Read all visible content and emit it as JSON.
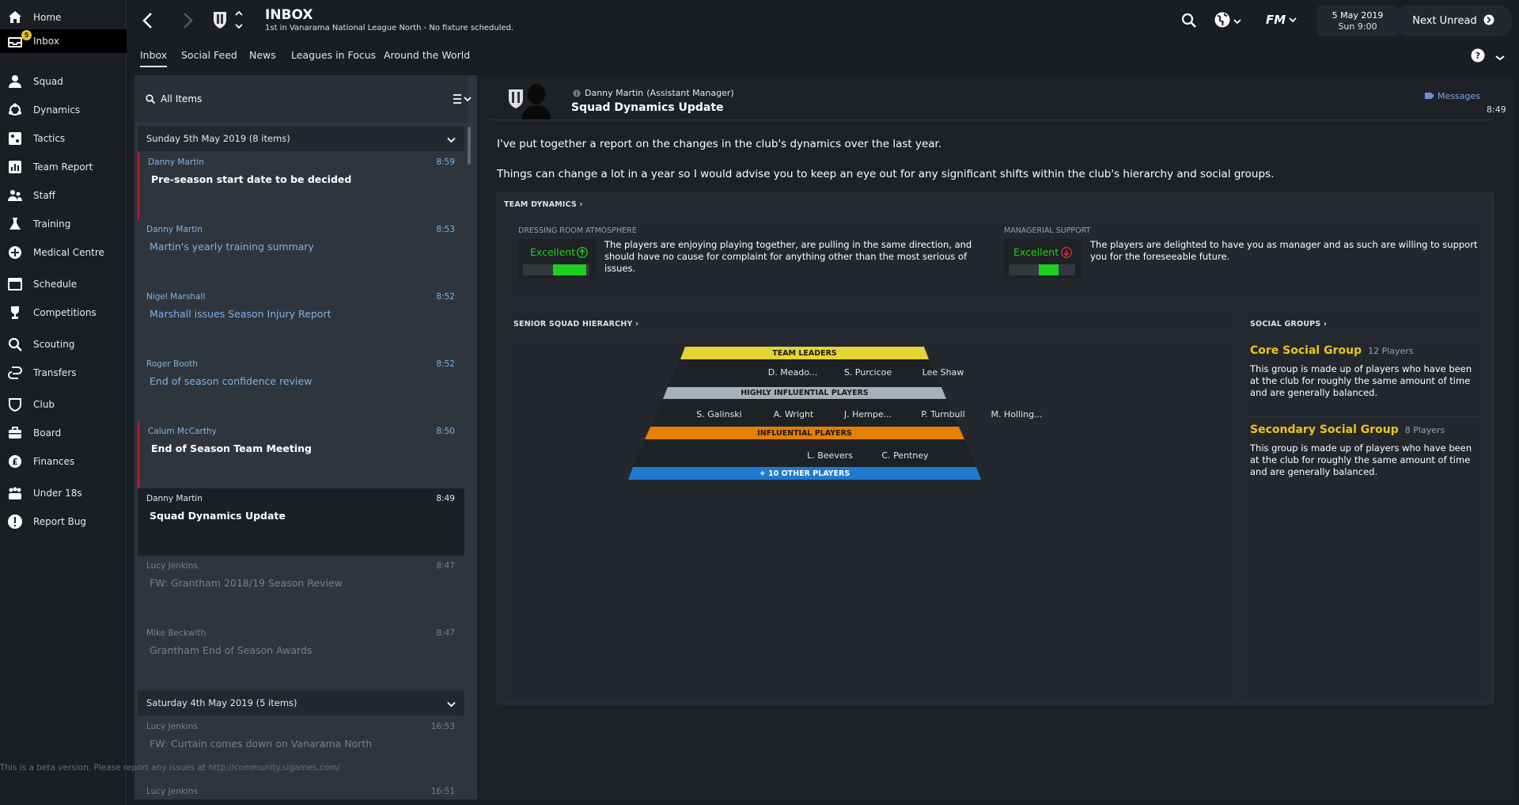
{
  "sidebar": {
    "items": [
      {
        "label": "Home",
        "icon": "home-icon"
      },
      {
        "label": "Inbox",
        "icon": "inbox-icon",
        "badge": "5"
      },
      {
        "label": "Squad",
        "icon": "squad-icon"
      },
      {
        "label": "Dynamics",
        "icon": "dynamics-icon"
      },
      {
        "label": "Tactics",
        "icon": "tactics-icon"
      },
      {
        "label": "Team Report",
        "icon": "team-report-icon"
      },
      {
        "label": "Staff",
        "icon": "staff-icon"
      },
      {
        "label": "Training",
        "icon": "training-icon"
      },
      {
        "label": "Medical Centre",
        "icon": "medical-icon"
      },
      {
        "label": "Schedule",
        "icon": "schedule-icon"
      },
      {
        "label": "Competitions",
        "icon": "trophy-icon"
      },
      {
        "label": "Scouting",
        "icon": "search-icon"
      },
      {
        "label": "Transfers",
        "icon": "transfers-icon"
      },
      {
        "label": "Club",
        "icon": "club-icon"
      },
      {
        "label": "Board",
        "icon": "board-icon"
      },
      {
        "label": "Finances",
        "icon": "finances-icon"
      },
      {
        "label": "Under 18s",
        "icon": "under18-icon"
      },
      {
        "label": "Report Bug",
        "icon": "bug-icon"
      }
    ]
  },
  "header": {
    "title": "INBOX",
    "subtitle": "1st in Vanarama National League North - No fixture scheduled.",
    "date": "5 May 2019",
    "time": "Sun 9:00",
    "next_unread": "Next Unread",
    "fm_label": "FM"
  },
  "tabs": [
    "Inbox",
    "Social Feed",
    "News",
    "Leagues in Focus",
    "Around the World"
  ],
  "list": {
    "filter": "All Items",
    "groups": [
      {
        "header": "Sunday 5th May 2019 (8 items)",
        "messages": [
          {
            "from": "Danny Martin",
            "time": "8:59",
            "subject": "Pre-season start date to be decided",
            "state": "unread"
          },
          {
            "from": "Danny Martin",
            "time": "8:53",
            "subject": "Martin's yearly training summary",
            "state": "new"
          },
          {
            "from": "Nigel Marshall",
            "time": "8:52",
            "subject": "Marshall issues Season Injury Report",
            "state": "new"
          },
          {
            "from": "Roger Booth",
            "time": "8:52",
            "subject": "End of season confidence review",
            "state": "new"
          },
          {
            "from": "Calum McCarthy",
            "time": "8:50",
            "subject": "End of Season Team Meeting",
            "state": "unread"
          },
          {
            "from": "Danny Martin",
            "time": "8:49",
            "subject": "Squad Dynamics Update",
            "state": "selected"
          },
          {
            "from": "Lucy Jenkins",
            "time": "8:47",
            "subject": "FW: Grantham 2018/19 Season Review",
            "state": "read"
          },
          {
            "from": "Mike Beckwith",
            "time": "8:47",
            "subject": "Grantham End of Season Awards",
            "state": "read"
          }
        ]
      },
      {
        "header": "Saturday 4th May 2019 (5 items)",
        "messages": [
          {
            "from": "Lucy Jenkins",
            "time": "16:53",
            "subject": "FW: Curtain comes down on Vanarama North",
            "state": "read"
          },
          {
            "from": "Lucy Jenkins",
            "time": "16:51",
            "subject": "",
            "state": "read"
          }
        ]
      }
    ]
  },
  "beta_notice": "This is a beta version. Please report any issues at http://community.sigames.com/",
  "message": {
    "sender": "Danny Martin",
    "role": "(Assistant Manager)",
    "subject": "Squad Dynamics Update",
    "messages_link": "Messages",
    "time": "8:49",
    "body": [
      "I've put together a report on the changes in the club's dynamics over the last year.",
      "Things can change a lot in a year so I would advise you to keep an eye out for any significant shifts within the club's hierarchy and social groups."
    ]
  },
  "team_dynamics": {
    "title": "TEAM DYNAMICS",
    "atmosphere": {
      "label": "DRESSING ROOM ATMOSPHERE",
      "rating": "Excellent",
      "trend": "up",
      "level": 0.95,
      "text": "The players are enjoying playing together, are pulling in the same direction, and should have no cause for complaint for anything other than the most serious of issues."
    },
    "support": {
      "label": "MANAGERIAL SUPPORT",
      "rating": "Excellent",
      "trend": "down",
      "level": 0.75,
      "text": "The players are delighted to have you as manager and as such are willing to support you for the foreseeable future."
    }
  },
  "hierarchy": {
    "title": "SENIOR SQUAD HIERARCHY",
    "team_leaders_label": "TEAM LEADERS",
    "team_leaders": [
      "D. Meado...",
      "S. Purcicoe",
      "Lee Shaw"
    ],
    "highly_label": "HIGHLY INFLUENTIAL PLAYERS",
    "highly": [
      "S. Galinski",
      "A. Wright",
      "J. Hempe...",
      "P. Turnbull",
      "M. Holling..."
    ],
    "influential_label": "INFLUENTIAL PLAYERS",
    "influential": [
      "L. Beevers",
      "C. Pentney"
    ],
    "others_label": "+ 10 OTHER PLAYERS"
  },
  "social_groups": {
    "title": "SOCIAL GROUPS",
    "groups": [
      {
        "name": "Core Social Group",
        "count": "12 Players",
        "text": "This group is made up of players who have been at the club for roughly the same amount of time and are generally balanced."
      },
      {
        "name": "Secondary Social Group",
        "count": "8 Players",
        "text": "This group is made up of players who have been at the club for roughly the same amount of time and are generally balanced."
      }
    ]
  },
  "colors": {
    "accent_gold": "#f0c419",
    "link_blue": "#7fb2e5",
    "green": "#1fcf1f",
    "orange": "#e67e00",
    "blue": "#1f7ad1",
    "silver": "#a9b1b8",
    "flag_red": "#c0202e"
  }
}
